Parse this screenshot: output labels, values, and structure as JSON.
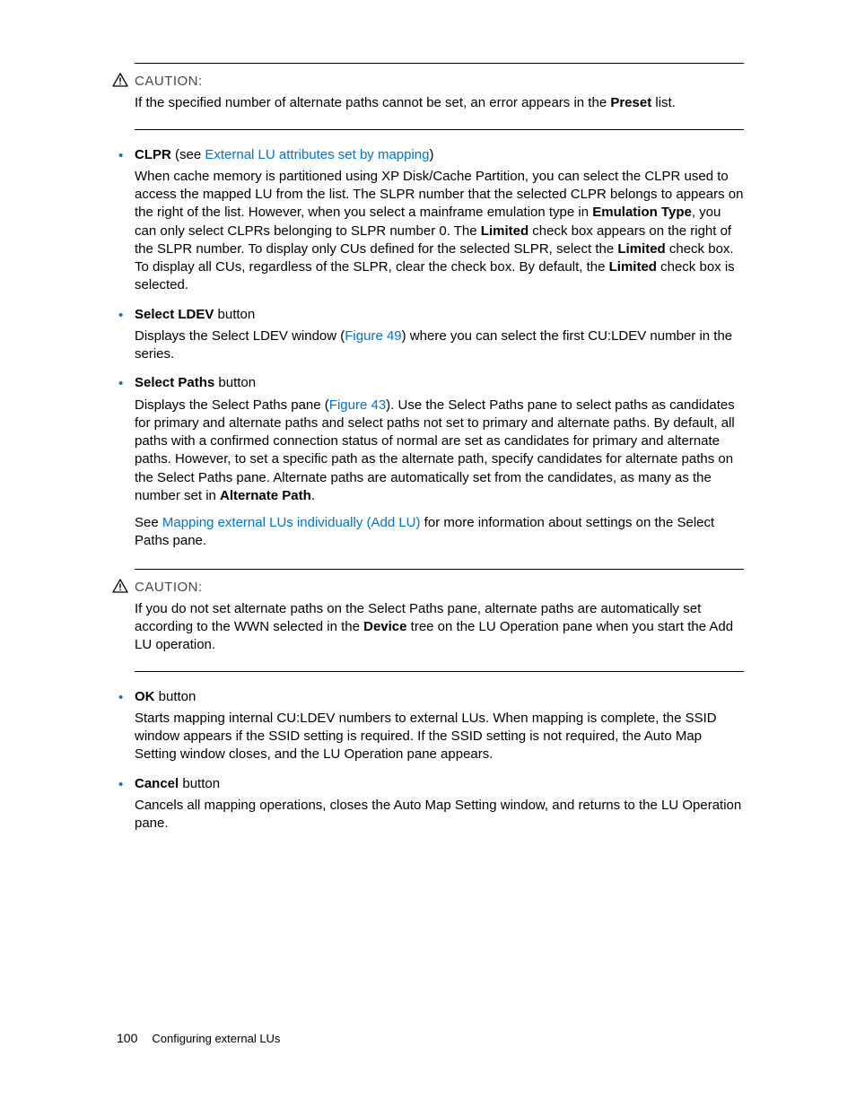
{
  "caution1": {
    "label": "CAUTION:",
    "text_before": "If the specified number of alternate paths cannot be set, an error appears in the ",
    "bold": "Preset",
    "text_after": " list."
  },
  "items": [
    {
      "head_bold": "CLPR",
      "head_plain": " (see ",
      "head_link": "External LU attributes set by mapping",
      "head_close": ")",
      "body1_a": "When cache memory is partitioned using XP Disk/Cache Partition, you can select the CLPR used to access the mapped LU from the list. The SLPR number that the selected CLPR belongs to appears on the right of the list. However, when you select a mainframe emulation type in ",
      "body1_b1": "Emulation Type",
      "body1_c": ", you can only select CLPRs belonging to SLPR number 0. The ",
      "body1_b2": "Limited",
      "body1_d": " check box appears on the right of the SLPR number. To display only CUs defined for the selected SLPR, select the ",
      "body1_b3": "Limited",
      "body1_e": " check box. To display all CUs, regardless of the SLPR, clear the check box. By default, the ",
      "body1_b4": "Limited",
      "body1_f": " check box is selected."
    },
    {
      "head_bold": "Select LDEV",
      "head_plain": " button",
      "body1_a": "Displays the Select LDEV window (",
      "body1_link": "Figure 49",
      "body1_b": ") where you can select the first CU:LDEV number in the series."
    },
    {
      "head_bold": "Select Paths",
      "head_plain": " button",
      "body1_a": "Displays the Select Paths pane (",
      "body1_link": "Figure 43",
      "body1_b": "). Use the Select Paths pane to select paths as candidates for primary and alternate paths and select paths not set to primary and alternate paths. By default, all paths with a confirmed connection status of normal are set as candidates for primary and alternate paths. However, to set a specific path as the alternate path, specify candidates for alternate paths on the Select Paths pane. Alternate paths are automatically set from the candidates, as many as the number set in ",
      "body1_bold": "Alternate Path",
      "body1_c": ".",
      "body2_a": "See ",
      "body2_link": "Mapping external LUs individually (Add LU)",
      "body2_b": " for more information about settings on the Select Paths pane."
    }
  ],
  "caution2": {
    "label": "CAUTION:",
    "text_a": "If you do not set alternate paths on the Select Paths pane, alternate paths are automatically set according to the WWN selected in the ",
    "bold": "Device",
    "text_b": " tree on the LU Operation pane when you start the Add LU operation."
  },
  "items2": [
    {
      "head_bold": "OK",
      "head_plain": " button",
      "body": "Starts mapping internal CU:LDEV numbers to external LUs. When mapping is complete, the SSID window appears if the SSID setting is required. If the SSID setting is not required, the Auto Map Setting window closes, and the LU Operation pane appears."
    },
    {
      "head_bold": "Cancel",
      "head_plain": " button",
      "body": "Cancels all mapping operations, closes the Auto Map Setting window, and returns to the LU Operation pane."
    }
  ],
  "footer": {
    "page": "100",
    "title": "Configuring external LUs"
  }
}
